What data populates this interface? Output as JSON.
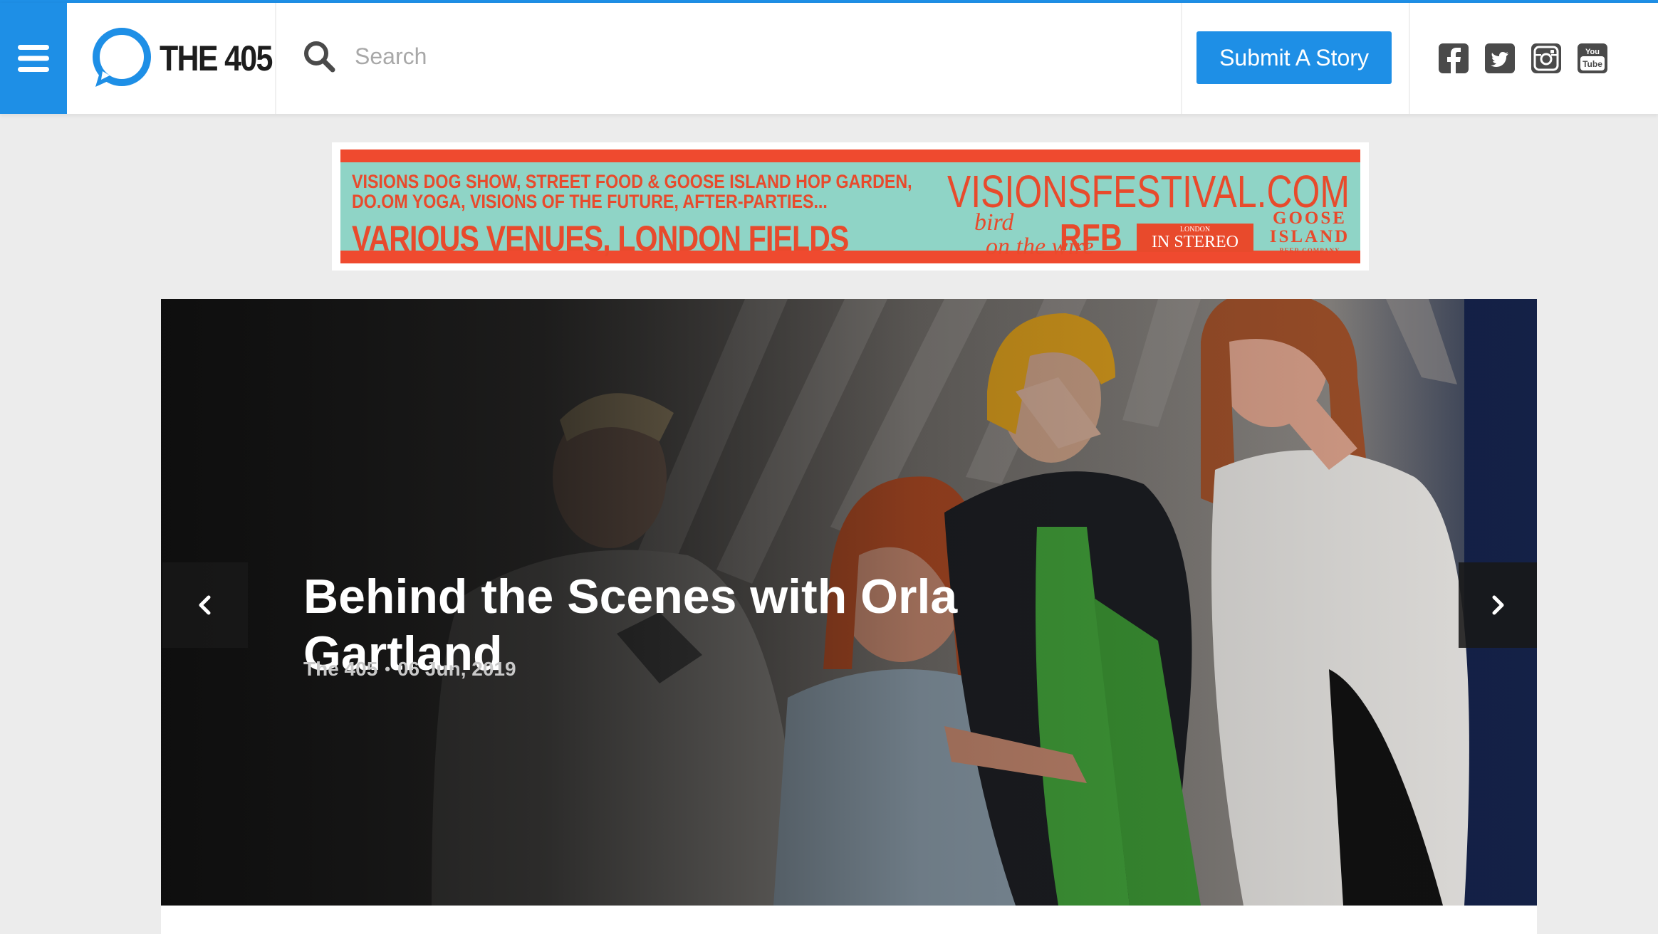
{
  "brand": {
    "logo_text": "THE 405",
    "accent_color": "#1e8fe6"
  },
  "header": {
    "menu_icon": "hamburger-icon",
    "search": {
      "icon": "search-icon",
      "placeholder": "Search"
    },
    "submit_label": "Submit A Story",
    "social": [
      {
        "icon": "facebook-icon"
      },
      {
        "icon": "twitter-icon"
      },
      {
        "icon": "instagram-icon"
      },
      {
        "icon": "youtube-icon"
      }
    ]
  },
  "ad": {
    "line1": "VISIONS DOG SHOW, STREET FOOD & GOOSE ISLAND HOP GARDEN,",
    "line2": "DO.OM YOGA, VISIONS OF THE FUTURE, AFTER-PARTIES...",
    "line3": "VARIOUS VENUES, LONDON FIELDS",
    "site": "VISIONSFESTIVAL.COM",
    "bird_line1": "bird",
    "bird_line2": "on the wire",
    "rfb": "RFB",
    "stereo_small": "LONDON",
    "stereo": "IN STEREO",
    "goose_line1": "GOOSE",
    "goose_line2": "ISLAND",
    "goose_line3": "BEER COMPANY",
    "colors": {
      "red": "#e84a2c",
      "mint": "#8fd4c6",
      "peach": "#f3a78f"
    }
  },
  "hero": {
    "title": "Behind the Scenes with Orla Gartland",
    "author": "The 405",
    "separator": "•",
    "date": "06 Jun, 2019",
    "prev_icon": "chevron-left-icon",
    "next_icon": "chevron-right-icon"
  }
}
